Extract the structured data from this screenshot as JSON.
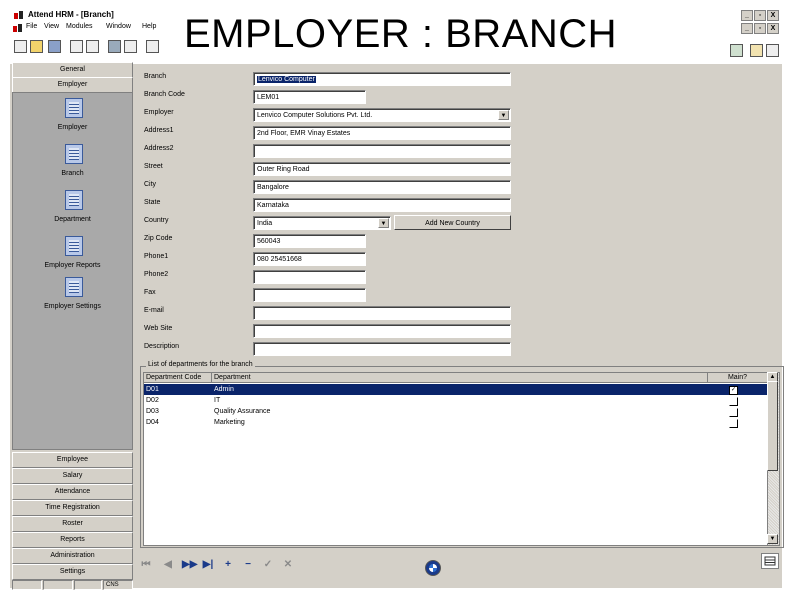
{
  "window": {
    "title": "Attend HRM - [Branch]",
    "controls": {
      "minimize": "_",
      "maximize": "▫",
      "close": "X"
    }
  },
  "heading": "EMPLOYER : BRANCH",
  "menu": [
    "File",
    "View",
    "Modules",
    "Window",
    "Help"
  ],
  "left_nav": {
    "top_buttons": [
      "General",
      "Employer"
    ],
    "entries": [
      "Employer",
      "Branch",
      "Department",
      "Employer Reports",
      "Employer Settings"
    ],
    "bottom_buttons": [
      "Employee",
      "Salary",
      "Attendance",
      "Time Registration",
      "Roster",
      "Reports",
      "Administration",
      "Settings"
    ]
  },
  "form": {
    "fields": [
      {
        "label": "Branch",
        "value": "Lenvico Computer",
        "selected": true
      },
      {
        "label": "Branch Code",
        "value": "LEM01"
      },
      {
        "label": "Employer",
        "value": "Lenvico Computer Solutions Pvt. Ltd."
      },
      {
        "label": "Address1",
        "value": "2nd Floor, EMR Vinay Estates"
      },
      {
        "label": "Address2",
        "value": ""
      },
      {
        "label": "Street",
        "value": "Outer Ring Road"
      },
      {
        "label": "City",
        "value": "Bangalore"
      },
      {
        "label": "State",
        "value": "Karnataka"
      },
      {
        "label": "Country",
        "value": "India"
      },
      {
        "label": "Zip Code",
        "value": "560043"
      },
      {
        "label": "Phone1",
        "value": "080 25451668"
      },
      {
        "label": "Phone2",
        "value": ""
      },
      {
        "label": "Fax",
        "value": ""
      },
      {
        "label": "E-mail",
        "value": ""
      },
      {
        "label": "Web Site",
        "value": ""
      },
      {
        "label": "Description",
        "value": ""
      }
    ],
    "add_country_button": "Add New Country"
  },
  "departments": {
    "caption": "List of departments for the branch",
    "columns": [
      "Department Code",
      "Department",
      "Main?"
    ],
    "rows": [
      {
        "code": "D01",
        "name": "Admin",
        "main": true
      },
      {
        "code": "D02",
        "name": "IT",
        "main": false
      },
      {
        "code": "D03",
        "name": "Quality Assurance",
        "main": false
      },
      {
        "code": "D04",
        "name": "Marketing",
        "main": false
      }
    ]
  },
  "navigator": {
    "buttons": [
      "first",
      "prior",
      "next",
      "last",
      "insert",
      "delete",
      "post",
      "cancel"
    ],
    "icons": {
      "first": "⏮",
      "prior": "◀",
      "next": "▶▶",
      "last": "▶|",
      "insert": "+",
      "delete": "−",
      "post": "✓",
      "cancel": "✕"
    }
  },
  "status": {
    "caps": "CNS"
  }
}
